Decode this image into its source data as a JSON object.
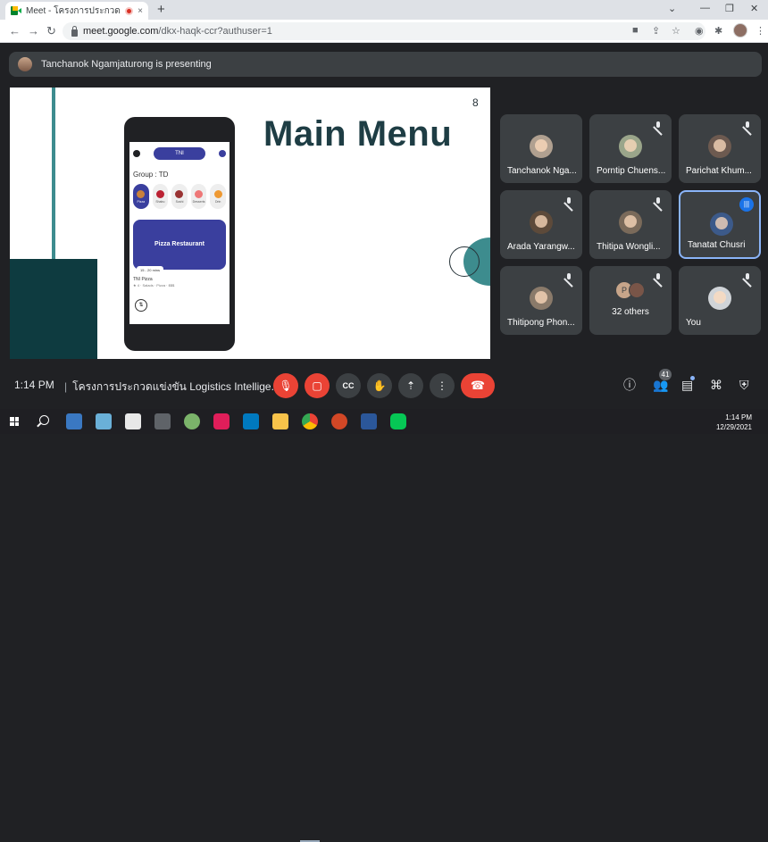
{
  "browser": {
    "tab_title": "Meet - โครงการประกวดแข่งขัน",
    "tab_close": "×",
    "new_tab": "+",
    "url_host": "meet.google.com",
    "url_path": "/dkx-haqk-ccr?authuser=1",
    "nav": {
      "back": "←",
      "forward": "→",
      "reload": "↻"
    },
    "window": {
      "minimize": "—",
      "restore": "❐",
      "close": "✕",
      "expand": "⌄"
    }
  },
  "presenting": {
    "text": "Tanchanok Ngamjaturong is presenting"
  },
  "slide": {
    "page_number": "8",
    "title": "Main Menu",
    "phone": {
      "pill": "TNI",
      "group": "Group : TD",
      "categories": [
        "Pizza",
        "Shabu",
        "Sushi",
        "Desserts",
        "Drin"
      ],
      "restaurant": "Pizza Restaurant",
      "time": "15 - 20 mins",
      "name": "TNI Pizza",
      "tags": "★ 4 · Salads · Pizza · $$$"
    }
  },
  "participants": [
    {
      "name": "Tanchanok Nga...",
      "muted": false,
      "active": false
    },
    {
      "name": "Porntip Chuens...",
      "muted": true,
      "active": false
    },
    {
      "name": "Parichat Khum...",
      "muted": true,
      "active": false
    },
    {
      "name": "Arada Yarangw...",
      "muted": true,
      "active": false
    },
    {
      "name": "Thitipa Wongli...",
      "muted": true,
      "active": false
    },
    {
      "name": "Tanatat Chusri",
      "muted": false,
      "active": true
    },
    {
      "name": "Thitipong Phon...",
      "muted": true,
      "active": false
    },
    {
      "name": "32 others",
      "muted": true,
      "active": false,
      "avatar_letter": "P"
    },
    {
      "name": "You",
      "muted": true,
      "active": false
    }
  ],
  "bottom_bar": {
    "time": "1:14 PM",
    "separator": "|",
    "meeting_title": "โครงการประกวดแข่งขัน Logistics Intellige...",
    "participant_count": "41"
  },
  "taskbar": {
    "time": "1:14 PM",
    "date": "12/29/2021"
  },
  "colors": {
    "meet_bg": "#202124",
    "tile_bg": "#3c4043",
    "red": "#ea4335",
    "slide_teal": "#3d8c8e",
    "slide_dark": "#0e3b40",
    "active_border": "#8ab4f8"
  }
}
